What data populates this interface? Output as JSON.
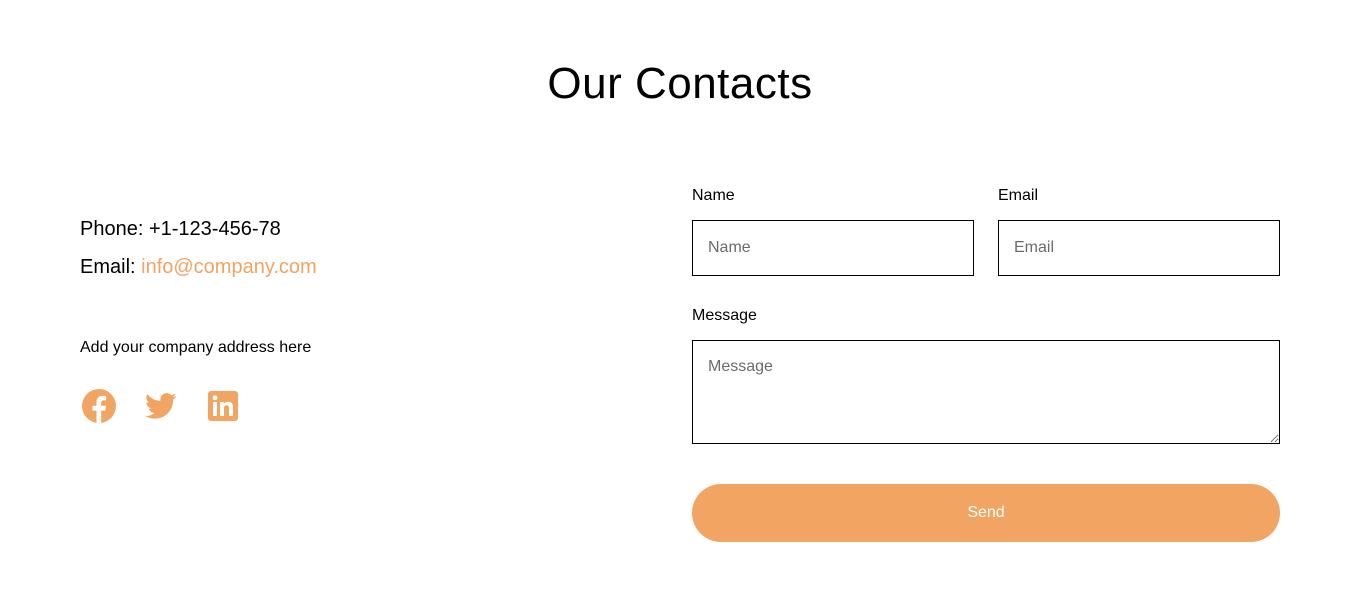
{
  "header": {
    "title": "Our Contacts"
  },
  "contact": {
    "phone_label": "Phone: ",
    "phone_value": "+1-123-456-78",
    "email_label": "Email: ",
    "email_value": "info@company.com",
    "address": "Add your company address here"
  },
  "socials": [
    {
      "icon": "facebook-icon"
    },
    {
      "icon": "twitter-icon"
    },
    {
      "icon": "linkedin-icon"
    }
  ],
  "form": {
    "name_label": "Name",
    "name_placeholder": "Name",
    "email_label": "Email",
    "email_placeholder": "Email",
    "message_label": "Message",
    "message_placeholder": "Message",
    "send_label": "Send"
  },
  "colors": {
    "accent": "#f2a463",
    "text": "#000000",
    "background": "#ffffff"
  }
}
